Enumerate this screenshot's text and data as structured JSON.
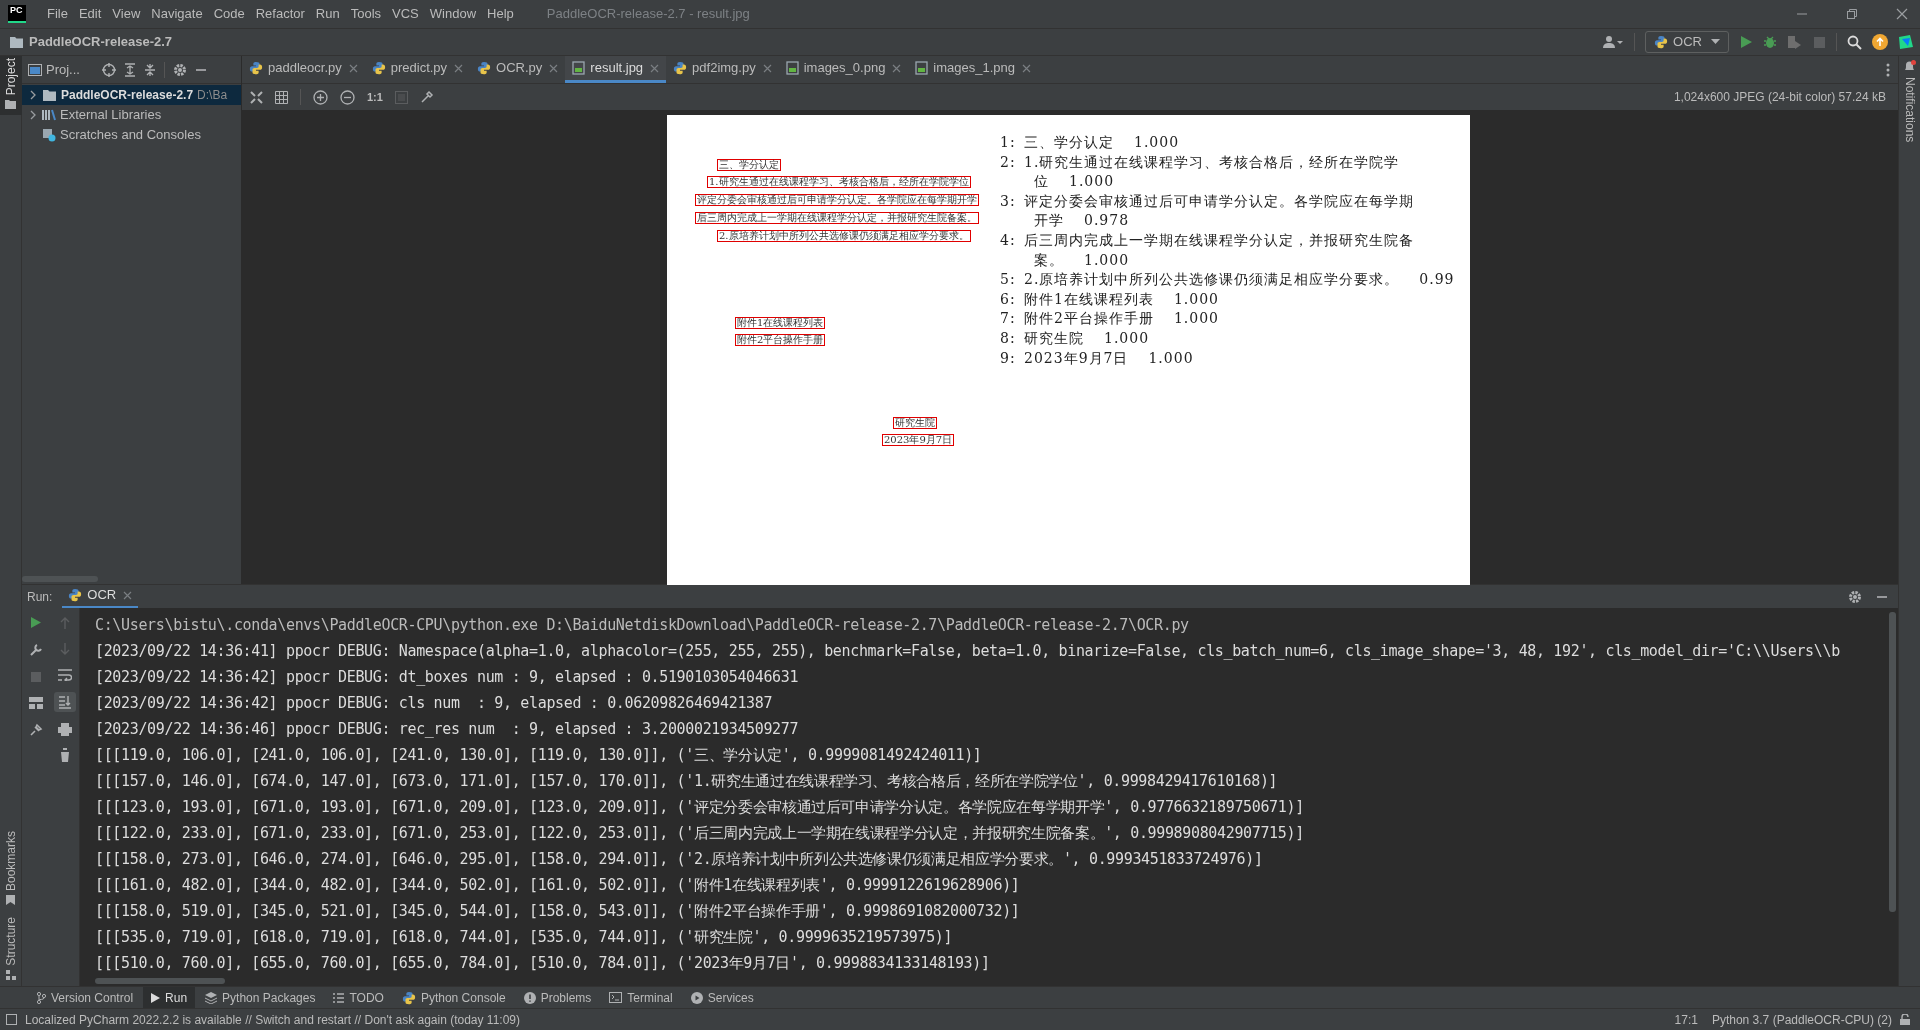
{
  "window": {
    "logo": "PC",
    "title": "PaddleOCR-release-2.7 - result.jpg"
  },
  "menu": [
    "File",
    "Edit",
    "View",
    "Navigate",
    "Code",
    "Refactor",
    "Run",
    "Tools",
    "VCS",
    "Window",
    "Help"
  ],
  "navbar": {
    "project": "PaddleOCR-release-2.7",
    "run_config": "OCR"
  },
  "left_stripe": {
    "top": "Project",
    "bottom": [
      "Bookmarks",
      "Structure"
    ]
  },
  "right_stripe": {
    "label": "Notifications"
  },
  "project_panel": {
    "title": "Proj...",
    "tree": [
      {
        "label": "PaddleOCR-release-2.7",
        "path": "D:\\Ba",
        "kind": "folder",
        "expanded": false,
        "selected": true
      },
      {
        "label": "External Libraries",
        "kind": "library",
        "expanded": false,
        "selected": false
      },
      {
        "label": "Scratches and Consoles",
        "kind": "scratches",
        "selected": false
      }
    ]
  },
  "tabs": [
    {
      "label": "paddleocr.py",
      "kind": "python",
      "selected": false
    },
    {
      "label": "predict.py",
      "kind": "python",
      "selected": false
    },
    {
      "label": "OCR.py",
      "kind": "python",
      "selected": false
    },
    {
      "label": "result.jpg",
      "kind": "image",
      "selected": true
    },
    {
      "label": "pdf2img.py",
      "kind": "python",
      "selected": false
    },
    {
      "label": "images_0.png",
      "kind": "image",
      "selected": false
    },
    {
      "label": "images_1.png",
      "kind": "image",
      "selected": false
    }
  ],
  "image_viewer": {
    "zoom_label": "1:1",
    "info": "1,024x600 JPEG (24-bit color) 57.24 kB",
    "detections": [
      "三、学分认定",
      "1.研究生通过在线课程学习、考核合格后，经所在学院学位",
      "评定分委会审核通过后可申请学分认定。各学院应在每学期开学",
      "后三周内完成上一学期在线课程学分认定，并报研究生院备案。",
      "2.原培养计划中所列公共选修课仍须满足相应学分要求。",
      "附件1在线课程列表",
      "附件2平台操作手册",
      "研究生院",
      "2023年9月7日"
    ],
    "results": [
      {
        "number": "1:",
        "lines": [
          "三、学分认定"
        ],
        "score": "1.000"
      },
      {
        "number": "2:",
        "lines": [
          "1.研究生通过在线课程学习、考核合格后，经所在学院学",
          "位"
        ],
        "score": "1.000"
      },
      {
        "number": "3:",
        "lines": [
          "评定分委会审核通过后可申请学分认定。各学院应在每学期",
          "开学"
        ],
        "score": "0.978"
      },
      {
        "number": "4:",
        "lines": [
          "后三周内完成上一学期在线课程学分认定，并报研究生院备",
          "案。"
        ],
        "score": "1.000"
      },
      {
        "number": "5:",
        "lines": [
          "2.原培养计划中所列公共选修课仍须满足相应学分要求。"
        ],
        "score": "0.99"
      },
      {
        "number": "6:",
        "lines": [
          "附件1在线课程列表"
        ],
        "score": "1.000"
      },
      {
        "number": "7:",
        "lines": [
          "附件2平台操作手册"
        ],
        "score": "1.000"
      },
      {
        "number": "8:",
        "lines": [
          "研究生院"
        ],
        "score": "1.000"
      },
      {
        "number": "9:",
        "lines": [
          "2023年9月7日"
        ],
        "score": "1.000"
      }
    ]
  },
  "run_panel": {
    "label": "Run:",
    "tab": "OCR",
    "lines": [
      "C:\\Users\\bistu\\.conda\\envs\\PaddleOCR-CPU\\python.exe D:\\BaiduNetdiskDownload\\PaddleOCR-release-2.7\\PaddleOCR-release-2.7\\OCR.py",
      "[2023/09/22 14:36:41] ppocr DEBUG: Namespace(alpha=1.0, alphacolor=(255, 255, 255), benchmark=False, beta=1.0, binarize=False, cls_batch_num=6, cls_image_shape='3, 48, 192', cls_model_dir='C:\\\\Users\\\\b",
      "[2023/09/22 14:36:42] ppocr DEBUG: dt_boxes num : 9, elapsed : 0.5190103054046631",
      "[2023/09/22 14:36:42] ppocr DEBUG: cls num  : 9, elapsed : 0.06209826469421387",
      "[2023/09/22 14:36:46] ppocr DEBUG: rec_res num  : 9, elapsed : 3.2000021934509277",
      "[[[119.0, 106.0], [241.0, 106.0], [241.0, 130.0], [119.0, 130.0]], ('三、学分认定', 0.9999081492424011)]",
      "[[[157.0, 146.0], [674.0, 147.0], [673.0, 171.0], [157.0, 170.0]], ('1.研究生通过在线课程学习、考核合格后，经所在学院学位', 0.9998429417610168)]",
      "[[[123.0, 193.0], [671.0, 193.0], [671.0, 209.0], [123.0, 209.0]], ('评定分委会审核通过后可申请学分认定。各学院应在每学期开学', 0.9776632189750671)]",
      "[[[122.0, 233.0], [671.0, 233.0], [671.0, 253.0], [122.0, 253.0]], ('后三周内完成上一学期在线课程学分认定，并报研究生院备案。', 0.9998908042907715)]",
      "[[[158.0, 273.0], [646.0, 274.0], [646.0, 295.0], [158.0, 294.0]], ('2.原培养计划中所列公共选修课仍须满足相应学分要求。', 0.9993451833724976)]",
      "[[[161.0, 482.0], [344.0, 482.0], [344.0, 502.0], [161.0, 502.0]], ('附件1在线课程列表', 0.9999122619628906)]",
      "[[[158.0, 519.0], [345.0, 521.0], [345.0, 544.0], [158.0, 543.0]], ('附件2平台操作手册', 0.9998691082000732)]",
      "[[[535.0, 719.0], [618.0, 719.0], [618.0, 744.0], [535.0, 744.0]], ('研究生院', 0.9999635219573975)]",
      "[[[510.0, 760.0], [655.0, 760.0], [655.0, 784.0], [510.0, 784.0]], ('2023年9月7日', 0.9998834133148193)]"
    ]
  },
  "tool_tabs": [
    {
      "label": "Version Control",
      "kind": "vcs",
      "selected": false
    },
    {
      "label": "Run",
      "kind": "run",
      "selected": true
    },
    {
      "label": "Python Packages",
      "kind": "packages",
      "selected": false
    },
    {
      "label": "TODO",
      "kind": "todo",
      "selected": false
    },
    {
      "label": "Python Console",
      "kind": "python",
      "selected": false
    },
    {
      "label": "Problems",
      "kind": "problems",
      "selected": false
    },
    {
      "label": "Terminal",
      "kind": "terminal",
      "selected": false
    },
    {
      "label": "Services",
      "kind": "services",
      "selected": false
    }
  ],
  "status_bar": {
    "message": "Localized PyCharm 2022.2.2 is available // Switch and restart // Don't ask again (today 11:09)",
    "position": "17:1",
    "interpreter": "Python 3.7 (PaddleOCR-CPU) (2)"
  }
}
